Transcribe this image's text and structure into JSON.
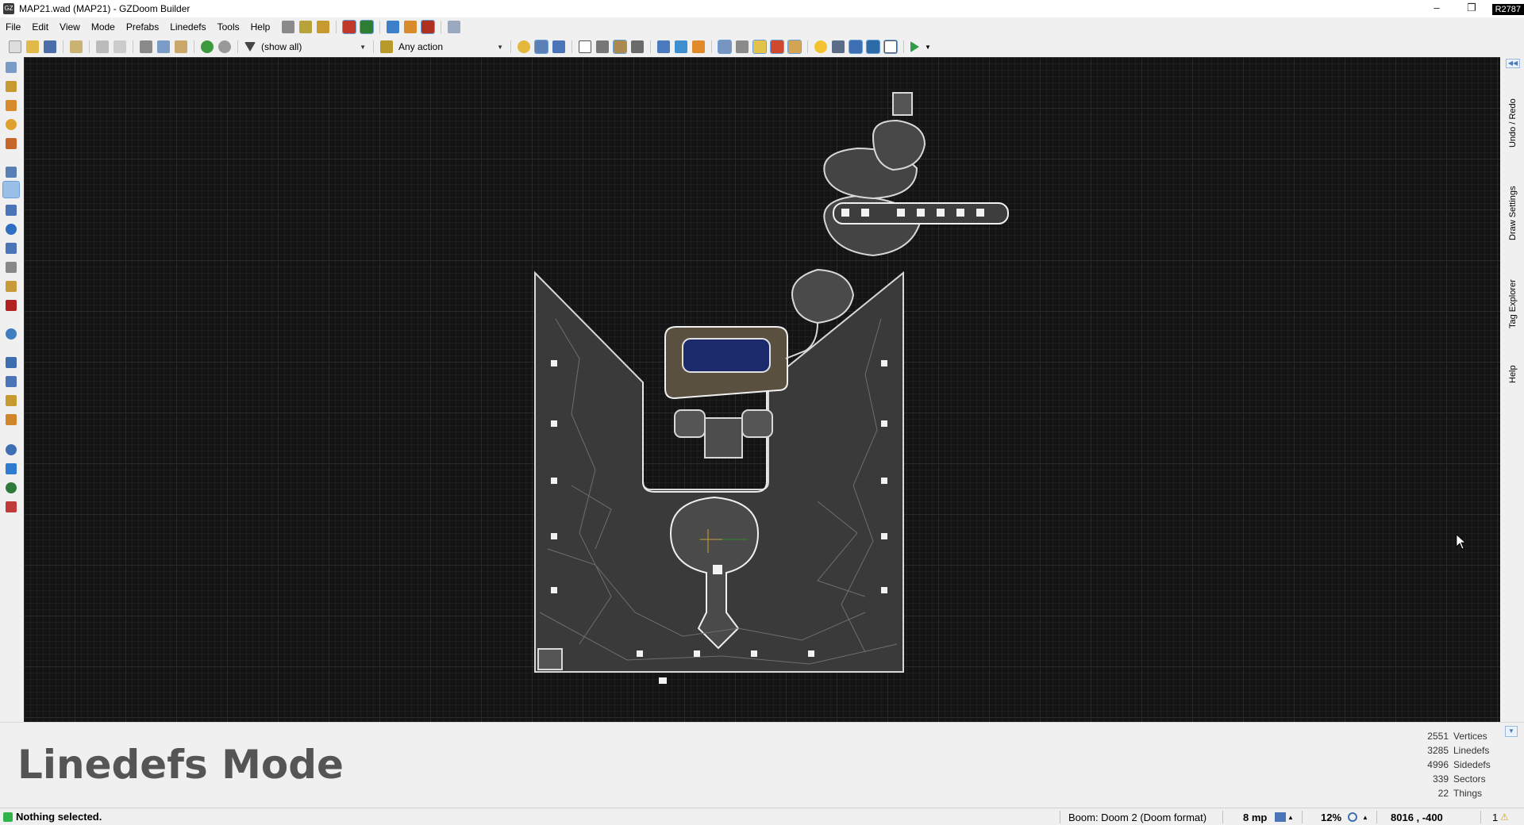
{
  "window": {
    "title": "MAP21.wad (MAP21) - GZDoom Builder",
    "revision": "R2787",
    "minimize": "–",
    "restore": "❐"
  },
  "menu": [
    "File",
    "Edit",
    "View",
    "Mode",
    "Prefabs",
    "Linedefs",
    "Tools",
    "Help"
  ],
  "toolbar": {
    "filter_value": "(show all)",
    "action_value": "Any action"
  },
  "dock_tabs": [
    "Undo / Redo",
    "Draw Settings",
    "Tag Explorer",
    "Help"
  ],
  "info": {
    "mode_title": "Linedefs Mode",
    "stats": [
      {
        "value": "2551",
        "label": "Vertices"
      },
      {
        "value": "3285",
        "label": "Linedefs"
      },
      {
        "value": "4996",
        "label": "Sidedefs"
      },
      {
        "value": "339",
        "label": "Sectors"
      },
      {
        "value": "22",
        "label": "Things"
      }
    ]
  },
  "status": {
    "message": "Nothing selected.",
    "game_config": "Boom: Doom 2 (Doom format)",
    "grid": "8 mp",
    "zoom": "12%",
    "coords": "8016 , -400",
    "warnings": "1"
  }
}
